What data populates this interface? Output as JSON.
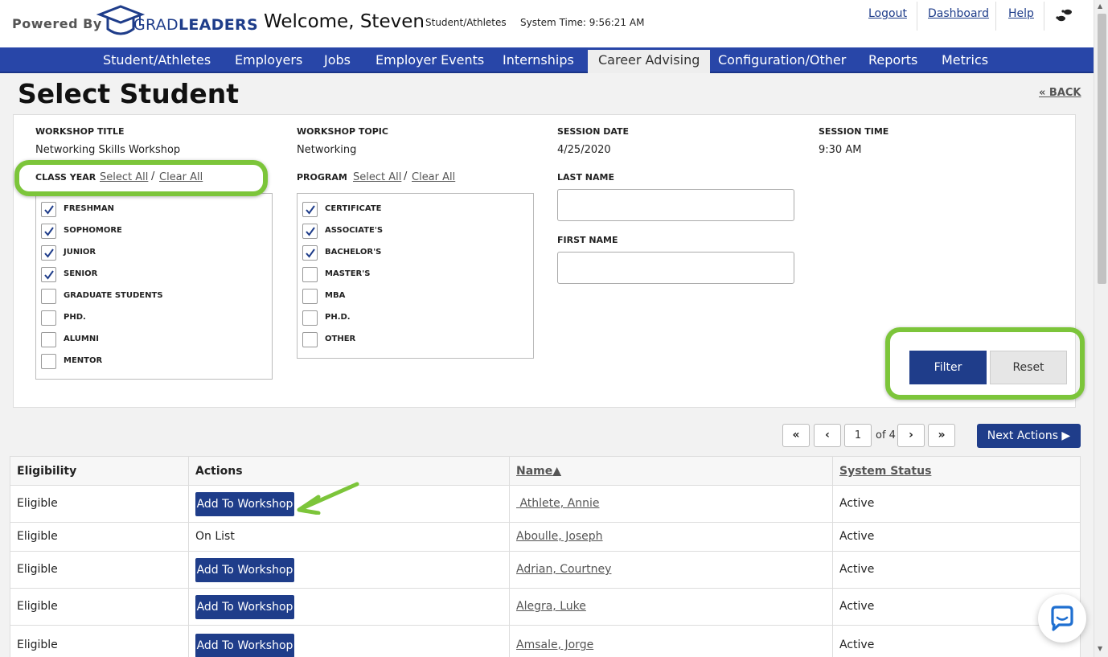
{
  "header": {
    "powered_by": "Powered By",
    "logo_text_light": "GRAD",
    "logo_text_bold": "LEADERS",
    "welcome": "Welcome, Steven",
    "role": "Student/Athletes",
    "system_time": "System Time: 9:56:21 AM",
    "links": [
      "Logout",
      "Dashboard",
      "Help"
    ]
  },
  "nav": {
    "items": [
      "Student/Athletes",
      "Employers",
      "Jobs",
      "Employer Events",
      "Internships",
      "Career Advising",
      "Configuration/Other",
      "Reports",
      "Metrics"
    ],
    "active": "Career Advising"
  },
  "page": {
    "title": "Select Student",
    "back": "« BACK"
  },
  "workshop": {
    "title_label": "WORKSHOP TITLE",
    "title_value": "Networking Skills Workshop",
    "topic_label": "WORKSHOP TOPIC",
    "topic_value": "Networking",
    "date_label": "SESSION DATE",
    "date_value": "4/25/2020",
    "time_label": "SESSION TIME",
    "time_value": "9:30 AM"
  },
  "class_year": {
    "label": "CLASS YEAR",
    "select_all": "Select All",
    "clear_all": "Clear All",
    "options": [
      {
        "label": "FRESHMAN",
        "checked": true
      },
      {
        "label": "SOPHOMORE",
        "checked": true
      },
      {
        "label": "JUNIOR",
        "checked": true
      },
      {
        "label": "SENIOR",
        "checked": true
      },
      {
        "label": "GRADUATE STUDENTS",
        "checked": false
      },
      {
        "label": "PHD.",
        "checked": false
      },
      {
        "label": "ALUMNI",
        "checked": false
      },
      {
        "label": "MENTOR",
        "checked": false
      }
    ]
  },
  "program": {
    "label": "PROGRAM",
    "select_all": "Select All",
    "clear_all": "Clear All",
    "options": [
      {
        "label": "CERTIFICATE",
        "checked": true
      },
      {
        "label": "ASSOCIATE'S",
        "checked": true
      },
      {
        "label": "BACHELOR'S",
        "checked": true
      },
      {
        "label": "MASTER'S",
        "checked": false
      },
      {
        "label": "MBA",
        "checked": false
      },
      {
        "label": "PH.D.",
        "checked": false
      },
      {
        "label": "OTHER",
        "checked": false
      }
    ]
  },
  "filters": {
    "last_name_label": "LAST NAME",
    "last_name_value": "",
    "first_name_label": "FIRST NAME",
    "first_name_value": "",
    "filter_button": "Filter",
    "reset_button": "Reset"
  },
  "pager": {
    "first": "«",
    "prev": "‹",
    "current_page": "1",
    "of_total": "of 4",
    "next": "›",
    "last": "»",
    "next_actions": "Next Actions ▶"
  },
  "table": {
    "headers": [
      "Eligibility",
      "Actions",
      "Name▲",
      "System Status"
    ],
    "rows": [
      {
        "eligibility": "Eligible",
        "action": "Add To Workshop",
        "action_is_button": true,
        "name": " Athlete, Annie",
        "status": "Active"
      },
      {
        "eligibility": "Eligible",
        "action": "On List",
        "action_is_button": false,
        "name": "Aboulle, Joseph",
        "status": "Active"
      },
      {
        "eligibility": "Eligible",
        "action": "Add To Workshop",
        "action_is_button": true,
        "name": "Adrian, Courtney",
        "status": "Active"
      },
      {
        "eligibility": "Eligible",
        "action": "Add To Workshop",
        "action_is_button": true,
        "name": "Alegra, Luke",
        "status": "Active"
      },
      {
        "eligibility": "Eligible",
        "action": "Add To Workshop",
        "action_is_button": true,
        "name": "Amsale, Jorge",
        "status": "Active"
      }
    ]
  },
  "colors": {
    "brand_blue": "#2846a8",
    "button_blue": "#1f3d8a",
    "highlight_green": "#7cc53a"
  }
}
